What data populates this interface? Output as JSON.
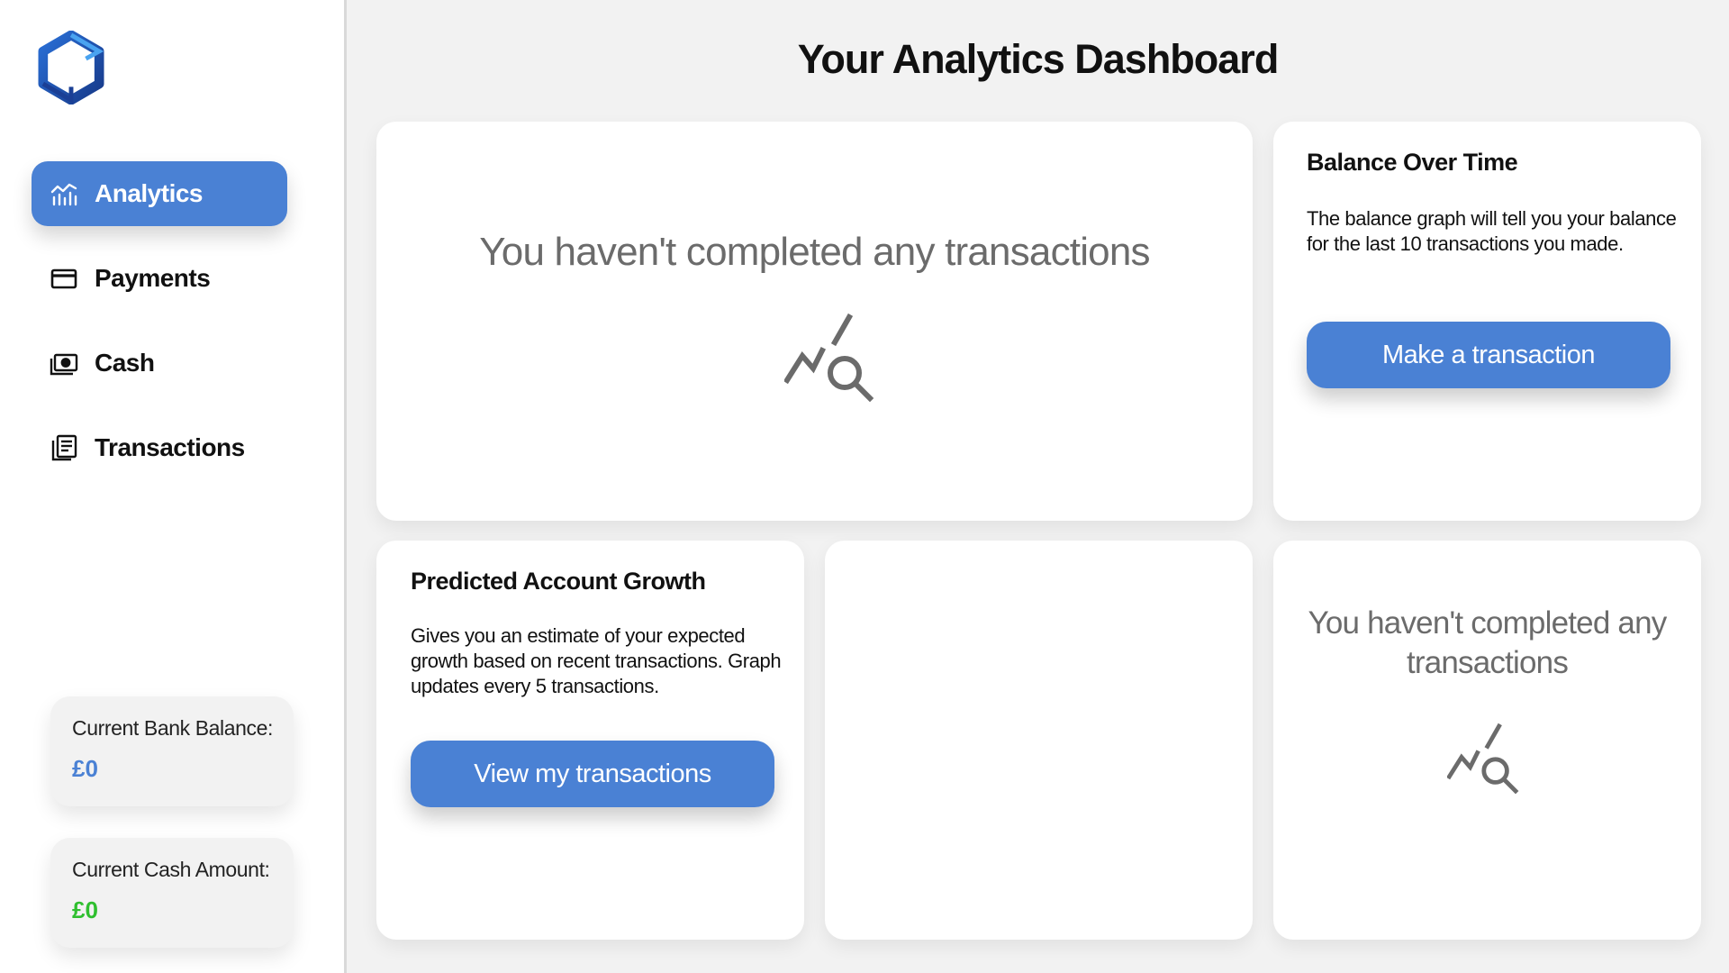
{
  "page": {
    "title": "Your Analytics Dashboard"
  },
  "sidebar": {
    "logo_icon": "hexagon-logo-icon",
    "items": [
      {
        "label": "Analytics",
        "icon": "chart-icon",
        "active": true
      },
      {
        "label": "Payments",
        "icon": "credit-card-icon",
        "active": false
      },
      {
        "label": "Cash",
        "icon": "cash-icon",
        "active": false
      },
      {
        "label": "Transactions",
        "icon": "receipt-list-icon",
        "active": false
      }
    ],
    "bank_balance": {
      "label": "Current Bank Balance:",
      "value": "£0",
      "color": "#4a81d4"
    },
    "cash_amount": {
      "label": "Current Cash Amount:",
      "value": "£0",
      "color": "#2fbf2f"
    }
  },
  "cards": {
    "main_empty": {
      "message": "You haven't completed any transactions",
      "icon": "chart-search-icon"
    },
    "balance_over_time": {
      "title": "Balance Over Time",
      "description": "The balance graph will tell you your balance for the last 10 transactions you made.",
      "button": "Make a transaction"
    },
    "predicted_growth": {
      "title": "Predicted Account Growth",
      "description": "Gives you an estimate of your expected growth based on recent transactions. Graph updates every 5 transactions.",
      "button": "View my transactions"
    },
    "small_empty": {
      "message": "You haven't completed any transactions",
      "icon": "chart-search-icon"
    }
  },
  "colors": {
    "accent": "#4a81d4",
    "background": "#f2f2f2",
    "muted_text": "#6b6b6b"
  }
}
